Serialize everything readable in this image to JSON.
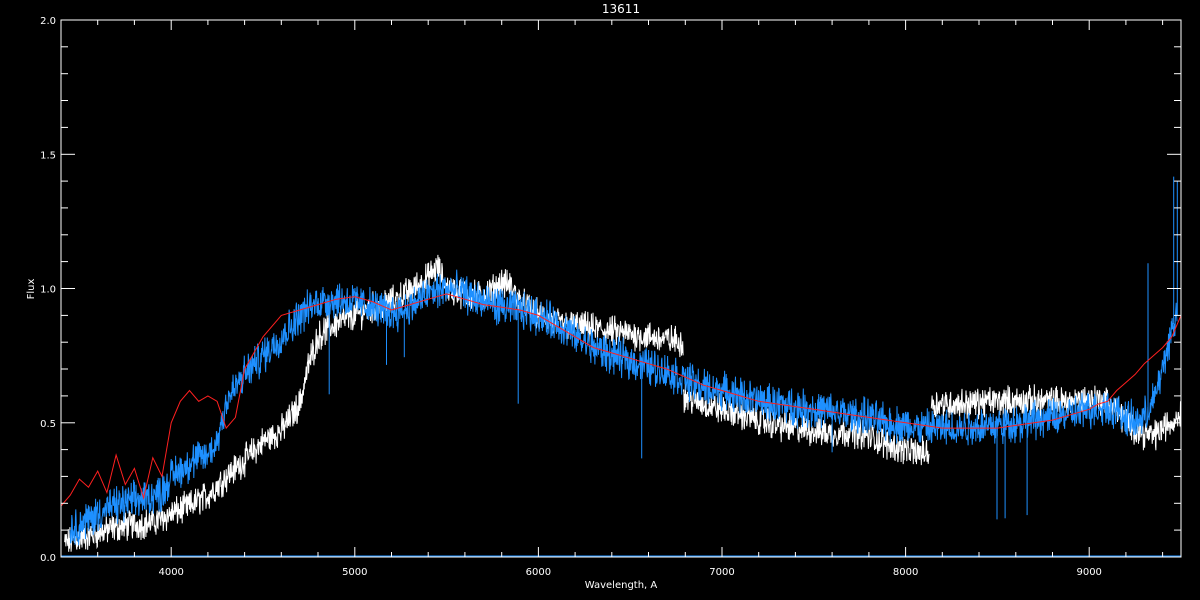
{
  "chart_data": {
    "type": "line",
    "title": "13611",
    "xlabel": "Wavelength, A",
    "ylabel": "Flux",
    "xlim": [
      3400,
      9500
    ],
    "ylim": [
      0,
      2.0
    ],
    "xticks_major": [
      4000,
      5000,
      6000,
      7000,
      8000,
      9000
    ],
    "xticks_minor_step": 200,
    "yticks_major": [
      0.0,
      0.5,
      1.0,
      1.5,
      2.0
    ],
    "yticks_minor_step": 0.1,
    "ytick_labels": [
      "0.0",
      "0.5",
      "1.0",
      "1.5",
      "2.0"
    ],
    "grid": false,
    "colors": {
      "background": "#000000",
      "axes": "#ffffff",
      "observed": "#ffffff",
      "model": "#1e90ff",
      "template": "#ff2020"
    },
    "series": [
      {
        "key": "observed",
        "color": "#ffffff",
        "noise": 0.045,
        "segments": [
          {
            "x": [
              3420,
              3500,
              3600,
              3700,
              3800,
              3900,
              4000,
              4100,
              4200,
              4300,
              4400,
              4500,
              4600,
              4700,
              4750,
              4800,
              4850,
              4900,
              5000,
              5100,
              5200,
              5300,
              5400,
              5450,
              5500,
              5600,
              5700,
              5800,
              5850,
              5900,
              6000,
              6100,
              6200,
              6300,
              6400,
              6500,
              6600,
              6700,
              6790
            ],
            "y": [
              0.05,
              0.07,
              0.09,
              0.11,
              0.12,
              0.13,
              0.16,
              0.19,
              0.23,
              0.3,
              0.36,
              0.43,
              0.47,
              0.57,
              0.72,
              0.82,
              0.85,
              0.87,
              0.9,
              0.93,
              0.95,
              0.99,
              1.04,
              1.08,
              1.0,
              0.98,
              0.97,
              1.02,
              1.01,
              0.95,
              0.9,
              0.87,
              0.86,
              0.85,
              0.84,
              0.83,
              0.82,
              0.81,
              0.8
            ]
          },
          {
            "x": [
              6790,
              6900,
              7000,
              7100,
              7200,
              7300,
              7400,
              7500,
              7600,
              7700,
              7800,
              7900,
              8000,
              8050,
              8130
            ],
            "y": [
              0.6,
              0.57,
              0.55,
              0.53,
              0.51,
              0.49,
              0.48,
              0.47,
              0.46,
              0.47,
              0.45,
              0.42,
              0.4,
              0.39,
              0.39
            ]
          },
          {
            "x": [
              8140,
              8300,
              8500,
              8700,
              8900,
              9000,
              9100,
              9150,
              9200,
              9250,
              9300,
              9350,
              9400,
              9450,
              9500
            ],
            "y": [
              0.57,
              0.57,
              0.58,
              0.58,
              0.58,
              0.59,
              0.58,
              0.55,
              0.5,
              0.48,
              0.46,
              0.45,
              0.48,
              0.5,
              0.54
            ]
          }
        ]
      },
      {
        "key": "model",
        "color": "#1e90ff",
        "noise": 0.055,
        "segments": [
          {
            "x": [
              3450,
              3550,
              3650,
              3750,
              3850,
              3950,
              4000,
              4100,
              4200,
              4250,
              4300,
              4400,
              4500,
              4600,
              4700,
              4800,
              4900,
              5000,
              5100,
              5200,
              5300,
              5400,
              5500,
              5600,
              5700,
              5800,
              5900,
              6000,
              6100,
              6200,
              6300,
              6400,
              6500,
              6600,
              6700,
              6800,
              6900,
              7000,
              7100,
              7200,
              7300,
              7400,
              7500,
              7600,
              7700,
              7800,
              7900,
              8000,
              8100,
              8200,
              8300,
              8400,
              8500,
              8600,
              8700,
              8800,
              8900,
              9000,
              9100,
              9200,
              9250,
              9300,
              9350,
              9400,
              9450,
              9480
            ],
            "y": [
              0.1,
              0.14,
              0.18,
              0.2,
              0.22,
              0.24,
              0.3,
              0.35,
              0.38,
              0.43,
              0.58,
              0.68,
              0.75,
              0.82,
              0.9,
              0.95,
              0.96,
              0.95,
              0.93,
              0.91,
              0.93,
              0.98,
              1.0,
              0.98,
              0.95,
              0.93,
              0.92,
              0.9,
              0.87,
              0.82,
              0.78,
              0.75,
              0.73,
              0.71,
              0.69,
              0.66,
              0.63,
              0.62,
              0.6,
              0.58,
              0.57,
              0.56,
              0.55,
              0.54,
              0.53,
              0.52,
              0.5,
              0.49,
              0.48,
              0.48,
              0.48,
              0.49,
              0.49,
              0.5,
              0.51,
              0.52,
              0.53,
              0.55,
              0.56,
              0.52,
              0.5,
              0.52,
              0.58,
              0.7,
              0.85,
              0.9
            ]
          }
        ]
      },
      {
        "key": "template",
        "color": "#ff2020",
        "noise": 0.0,
        "segments": [
          {
            "x": [
              3400,
              3450,
              3500,
              3550,
              3600,
              3650,
              3700,
              3750,
              3800,
              3850,
              3900,
              3950,
              4000,
              4050,
              4100,
              4150,
              4200,
              4250,
              4300,
              4350,
              4400,
              4500,
              4600,
              4700,
              4800,
              4900,
              5000,
              5100,
              5200,
              5300,
              5400,
              5500,
              5600,
              5700,
              5800,
              5900,
              6000,
              6100,
              6200,
              6300,
              6400,
              6500,
              6600,
              6700,
              6800,
              6900,
              7000,
              7100,
              7200,
              7300,
              7400,
              7500,
              7600,
              7700,
              7800,
              7900,
              8000,
              8100,
              8200,
              8300,
              8400,
              8500,
              8600,
              8700,
              8800,
              8900,
              9000,
              9050,
              9100,
              9150,
              9200,
              9250,
              9300,
              9350,
              9400,
              9450,
              9500
            ],
            "y": [
              0.19,
              0.23,
              0.29,
              0.26,
              0.32,
              0.24,
              0.38,
              0.27,
              0.33,
              0.22,
              0.37,
              0.3,
              0.5,
              0.58,
              0.62,
              0.58,
              0.6,
              0.58,
              0.48,
              0.52,
              0.7,
              0.82,
              0.9,
              0.92,
              0.94,
              0.96,
              0.97,
              0.95,
              0.92,
              0.94,
              0.96,
              0.98,
              0.96,
              0.94,
              0.93,
              0.92,
              0.9,
              0.86,
              0.82,
              0.78,
              0.76,
              0.74,
              0.72,
              0.7,
              0.67,
              0.64,
              0.62,
              0.6,
              0.58,
              0.57,
              0.56,
              0.55,
              0.54,
              0.53,
              0.52,
              0.51,
              0.5,
              0.49,
              0.48,
              0.48,
              0.48,
              0.48,
              0.49,
              0.5,
              0.51,
              0.53,
              0.55,
              0.57,
              0.58,
              0.62,
              0.65,
              0.68,
              0.72,
              0.75,
              0.78,
              0.82,
              0.9
            ]
          }
        ]
      }
    ],
    "absorption_features": [
      {
        "x": [
          4861,
          5173,
          5270,
          5890,
          6563,
          7600,
          8498,
          8542,
          8662
        ],
        "depth": [
          0.35,
          0.2,
          0.18,
          0.35,
          0.35,
          0.15,
          0.35,
          0.35,
          0.35
        ]
      }
    ],
    "spike_features": [
      {
        "x": [
          9320,
          9460,
          9480
        ],
        "height": [
          0.55,
          0.55,
          0.5
        ]
      }
    ]
  }
}
